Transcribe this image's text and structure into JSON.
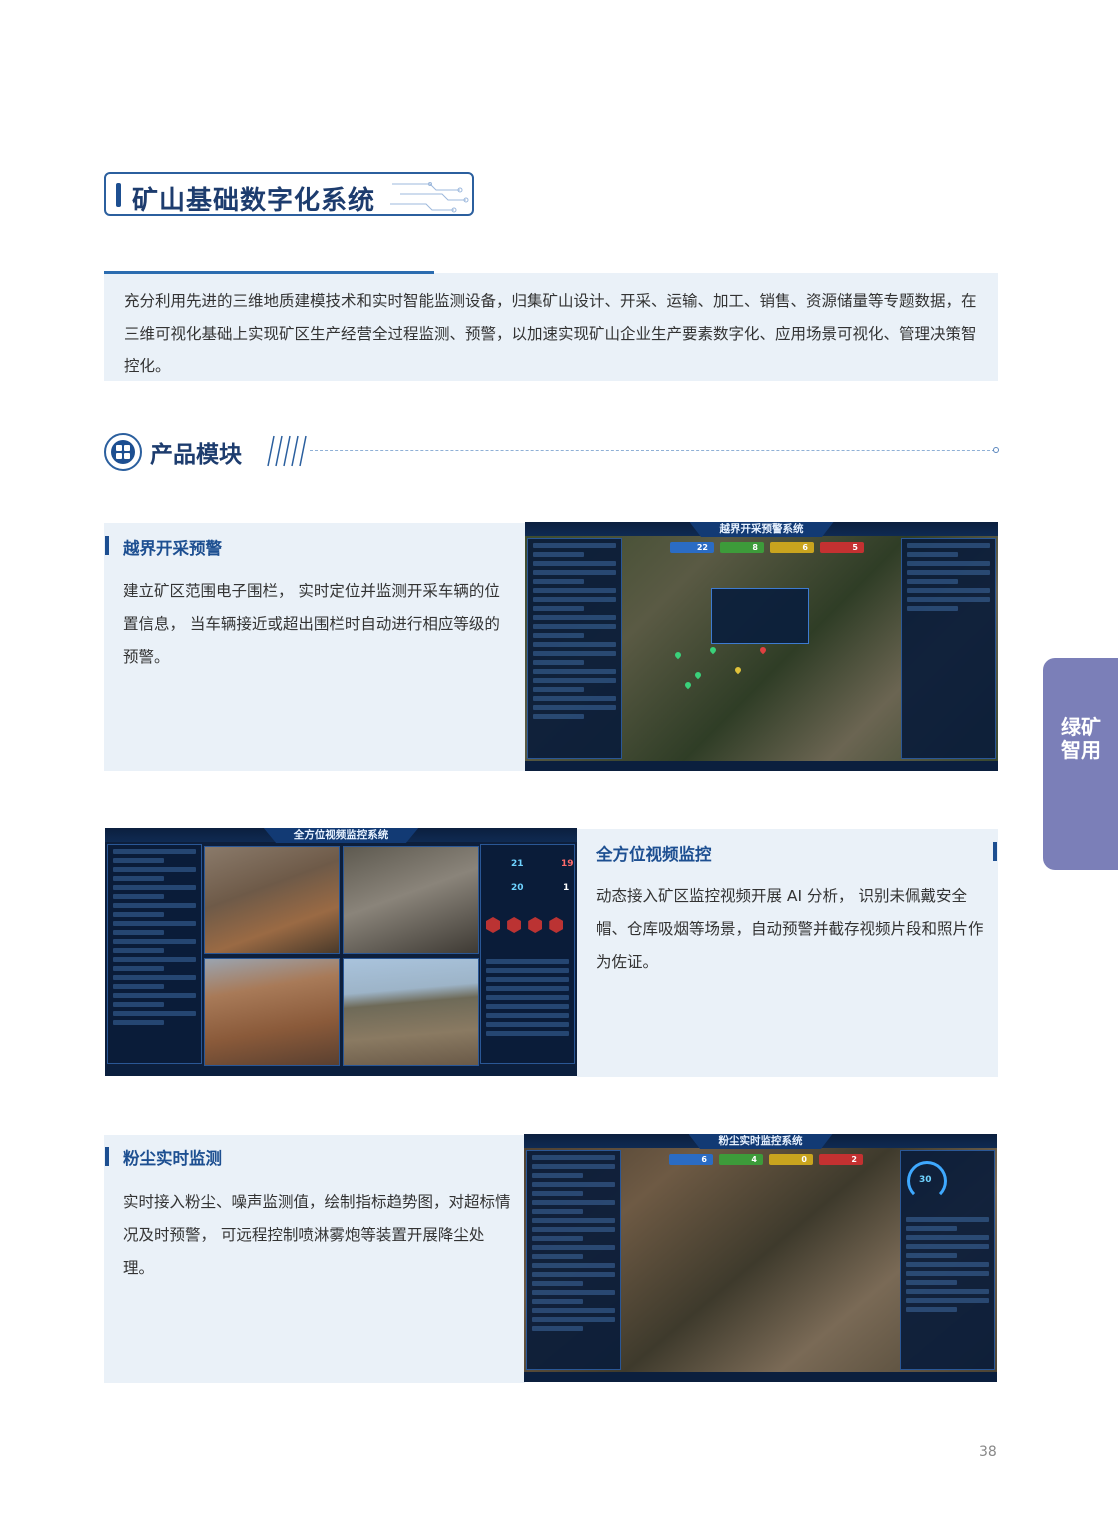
{
  "header": {
    "title": "矿山基础数字化系统"
  },
  "intro": {
    "text": "充分利用先进的三维地质建模技术和实时智能监测设备，归集矿山设计、开采、运输、加工、销售、资源储量等专题数据，在三维可视化基础上实现矿区生产经营全过程监测、预警，以加速实现矿山企业生产要素数字化、应用场景可视化、管理决策智控化。"
  },
  "module": {
    "title": "产品模块"
  },
  "features": [
    {
      "title": "越界开采预警",
      "text": "建立矿区范围电子围栏， 实时定位并监测开采车辆的位置信息， 当车辆接近或超出围栏时自动进行相应等级的预警。",
      "screen_title": "越界开采预警系统",
      "badges": [
        "22",
        "8",
        "6",
        "5"
      ]
    },
    {
      "title": "全方位视频监控",
      "text": "动态接入矿区监控视频开展 AI 分析， 识别未佩戴安全帽、仓库吸烟等场景，自动预警并截存视频片段和照片作为佐证。",
      "screen_title": "全方位视频监控系统",
      "stats": [
        "21",
        "19",
        "20",
        "1"
      ]
    },
    {
      "title": "粉尘实时监测",
      "text": "实时接入粉尘、噪声监测值，绘制指标趋势图，对超标情况及时预警， 可远程控制喷淋雾炮等装置开展降尘处理。",
      "screen_title": "粉尘实时监控系统",
      "badges": [
        "6",
        "4",
        "0",
        "2"
      ],
      "gauge": "30"
    }
  ],
  "side_tab": {
    "label": "绿矿智用"
  },
  "page_number": "38",
  "colors": {
    "primary": "#1d4f91",
    "panel_bg": "#eaf1f8",
    "tab": "#7b7fb8"
  }
}
